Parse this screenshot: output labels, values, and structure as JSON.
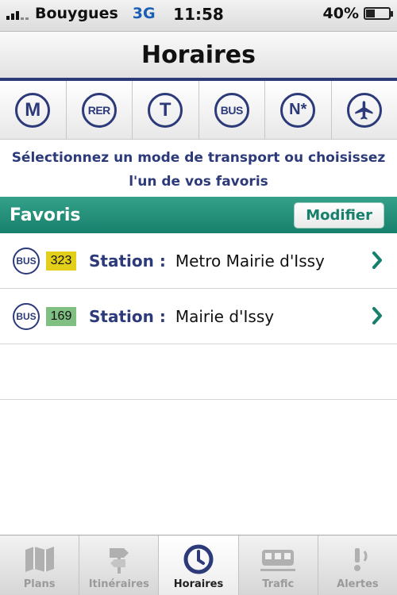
{
  "status_bar": {
    "carrier": "Bouygues",
    "network": "3G",
    "time": "11:58",
    "battery": "40%",
    "battery_level": 0.4
  },
  "nav": {
    "title": "Horaires"
  },
  "modes": [
    {
      "label": "M",
      "icon": "metro-icon"
    },
    {
      "label": "RER",
      "icon": "rer-icon"
    },
    {
      "label": "T",
      "icon": "tram-icon"
    },
    {
      "label": "BUS",
      "icon": "bus-icon"
    },
    {
      "label": "N*",
      "icon": "noctilien-icon"
    },
    {
      "label": "",
      "icon": "airplane-icon"
    }
  ],
  "instruction": "Sélectionnez un mode de transport ou choisissez l'un de vos favoris",
  "favoris": {
    "title": "Favoris",
    "modify_label": "Modifier",
    "items": [
      {
        "mode": "BUS",
        "line": "323",
        "line_color": "#e3cf1a",
        "station_label": "Station :",
        "station": "Metro Mairie d'Issy"
      },
      {
        "mode": "BUS",
        "line": "169",
        "line_color": "#7fbf82",
        "station_label": "Station :",
        "station": "Mairie d'Issy"
      }
    ]
  },
  "colors": {
    "brand_blue": "#2c3a7a",
    "green": "#17806c"
  },
  "tabs": [
    {
      "label": "Plans",
      "icon": "map-icon",
      "active": false
    },
    {
      "label": "Itinéraires",
      "icon": "route-sign-icon",
      "active": false
    },
    {
      "label": "Horaires",
      "icon": "clock-icon",
      "active": true
    },
    {
      "label": "Trafic",
      "icon": "train-icon",
      "active": false
    },
    {
      "label": "Alertes",
      "icon": "alert-icon",
      "active": false
    }
  ]
}
